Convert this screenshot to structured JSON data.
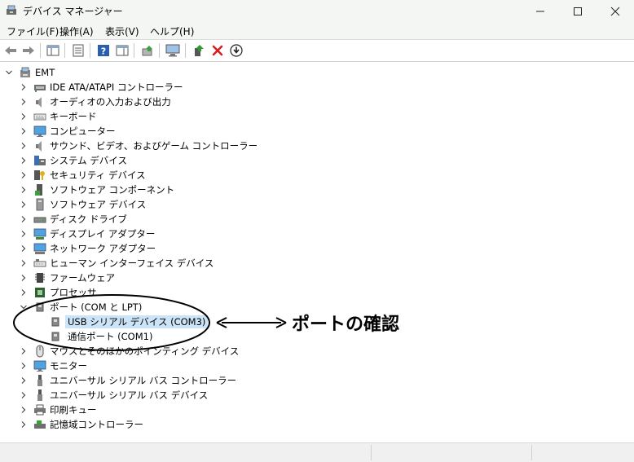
{
  "window": {
    "title": "デバイス マネージャー"
  },
  "menu": [
    {
      "label": "ファイル(F)"
    },
    {
      "label": "操作(A)"
    },
    {
      "label": "表示(V)"
    },
    {
      "label": "ヘルプ(H)"
    }
  ],
  "tree": {
    "root": "EMT",
    "categories": [
      {
        "label": "IDE ATA/ATAPI コントローラー",
        "icon": "ide-controller-icon"
      },
      {
        "label": "オーディオの入力および出力",
        "icon": "speaker-icon"
      },
      {
        "label": "キーボード",
        "icon": "keyboard-icon"
      },
      {
        "label": "コンピューター",
        "icon": "monitor-icon"
      },
      {
        "label": "サウンド、ビデオ、およびゲーム コントローラー",
        "icon": "speaker-icon"
      },
      {
        "label": "システム デバイス",
        "icon": "system-device-icon"
      },
      {
        "label": "セキュリティ デバイス",
        "icon": "security-key-icon"
      },
      {
        "label": "ソフトウェア コンポーネント",
        "icon": "software-component-icon"
      },
      {
        "label": "ソフトウェア デバイス",
        "icon": "software-device-icon"
      },
      {
        "label": "ディスク ドライブ",
        "icon": "disk-drive-icon"
      },
      {
        "label": "ディスプレイ アダプター",
        "icon": "display-adapter-icon"
      },
      {
        "label": "ネットワーク アダプター",
        "icon": "network-adapter-icon"
      },
      {
        "label": "ヒューマン インターフェイス デバイス",
        "icon": "hid-icon"
      },
      {
        "label": "ファームウェア",
        "icon": "firmware-chip-icon"
      },
      {
        "label": "プロセッサ",
        "icon": "processor-icon"
      },
      {
        "label": "ポート (COM と LPT)",
        "icon": "port-icon",
        "expanded": true,
        "children": [
          {
            "label": "USB シリアル デバイス (COM3)",
            "selected": true
          },
          {
            "label": "通信ポート (COM1)",
            "selected": false
          }
        ]
      },
      {
        "label": "マウスとそのほかのポインティング デバイス",
        "icon": "mouse-icon"
      },
      {
        "label": "モニター",
        "icon": "monitor-icon"
      },
      {
        "label": "ユニバーサル シリアル バス コントローラー",
        "icon": "usb-icon"
      },
      {
        "label": "ユニバーサル シリアル バス デバイス",
        "icon": "usb-icon"
      },
      {
        "label": "印刷キュー",
        "icon": "printer-icon"
      },
      {
        "label": "記憶域コントローラー",
        "icon": "storage-controller-icon"
      }
    ]
  },
  "annotation": {
    "text": "ポートの確認"
  },
  "colors": {
    "selection": "#cce4f7",
    "annotation": "#000000",
    "delete": "#d42020",
    "help": "#2b5fad"
  }
}
